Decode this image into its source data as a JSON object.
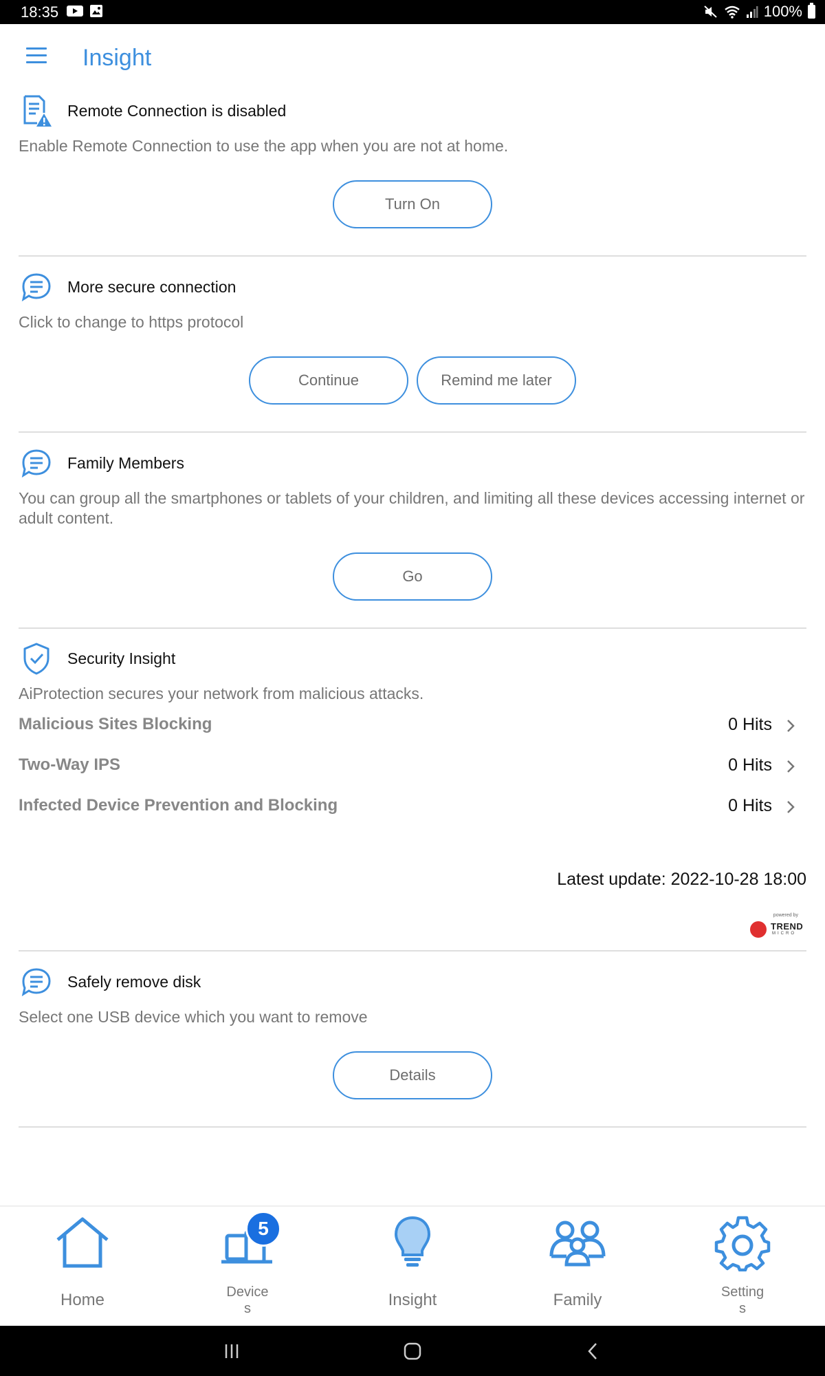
{
  "status_bar": {
    "time": "18:35",
    "battery": "100%"
  },
  "app": {
    "title": "Insight"
  },
  "sections": [
    {
      "title": "Remote Connection is disabled",
      "description": "Enable Remote Connection to use the app when you are not at home.",
      "buttons": [
        "Turn On"
      ],
      "icon": "document-warning-icon"
    },
    {
      "title": "More secure connection",
      "description": "Click to change to https protocol",
      "buttons": [
        "Continue",
        "Remind me later"
      ],
      "icon": "chat-icon"
    },
    {
      "title": "Family Members",
      "description": "You can group all the smartphones or tablets of your children, and limiting all these devices accessing internet or adult content.",
      "buttons": [
        "Go"
      ],
      "icon": "chat-icon"
    },
    {
      "title": "Safely remove disk",
      "description": "Select one USB device which you want to remove",
      "buttons": [
        "Details"
      ],
      "icon": "chat-icon"
    }
  ],
  "security": {
    "title": "Security Insight",
    "description": "AiProtection secures your network from malicious attacks.",
    "items": [
      {
        "label": "Malicious Sites Blocking",
        "value": "0 Hits"
      },
      {
        "label": "Two-Way IPS",
        "value": "0 Hits"
      },
      {
        "label": "Infected Device Prevention and Blocking",
        "value": "0 Hits"
      }
    ],
    "latest_update": "Latest update: 2022-10-28 18:00",
    "vendor_logo": {
      "powered_by": "powered by",
      "brand": "TREND",
      "brand_sub": "MICRO"
    },
    "icon": "shield-check-icon"
  },
  "bottom_nav": [
    {
      "label": "Home",
      "icon": "home-icon"
    },
    {
      "label": "Device\ns",
      "icon": "devices-icon",
      "badge": "5"
    },
    {
      "label": "Insight",
      "icon": "lightbulb-icon",
      "active": true
    },
    {
      "label": "Family",
      "icon": "family-icon"
    },
    {
      "label": "Setting\ns",
      "icon": "gear-icon"
    }
  ],
  "colors": {
    "accent": "#3d8fde",
    "badge": "#1a6fe0",
    "divider": "#dedede"
  }
}
